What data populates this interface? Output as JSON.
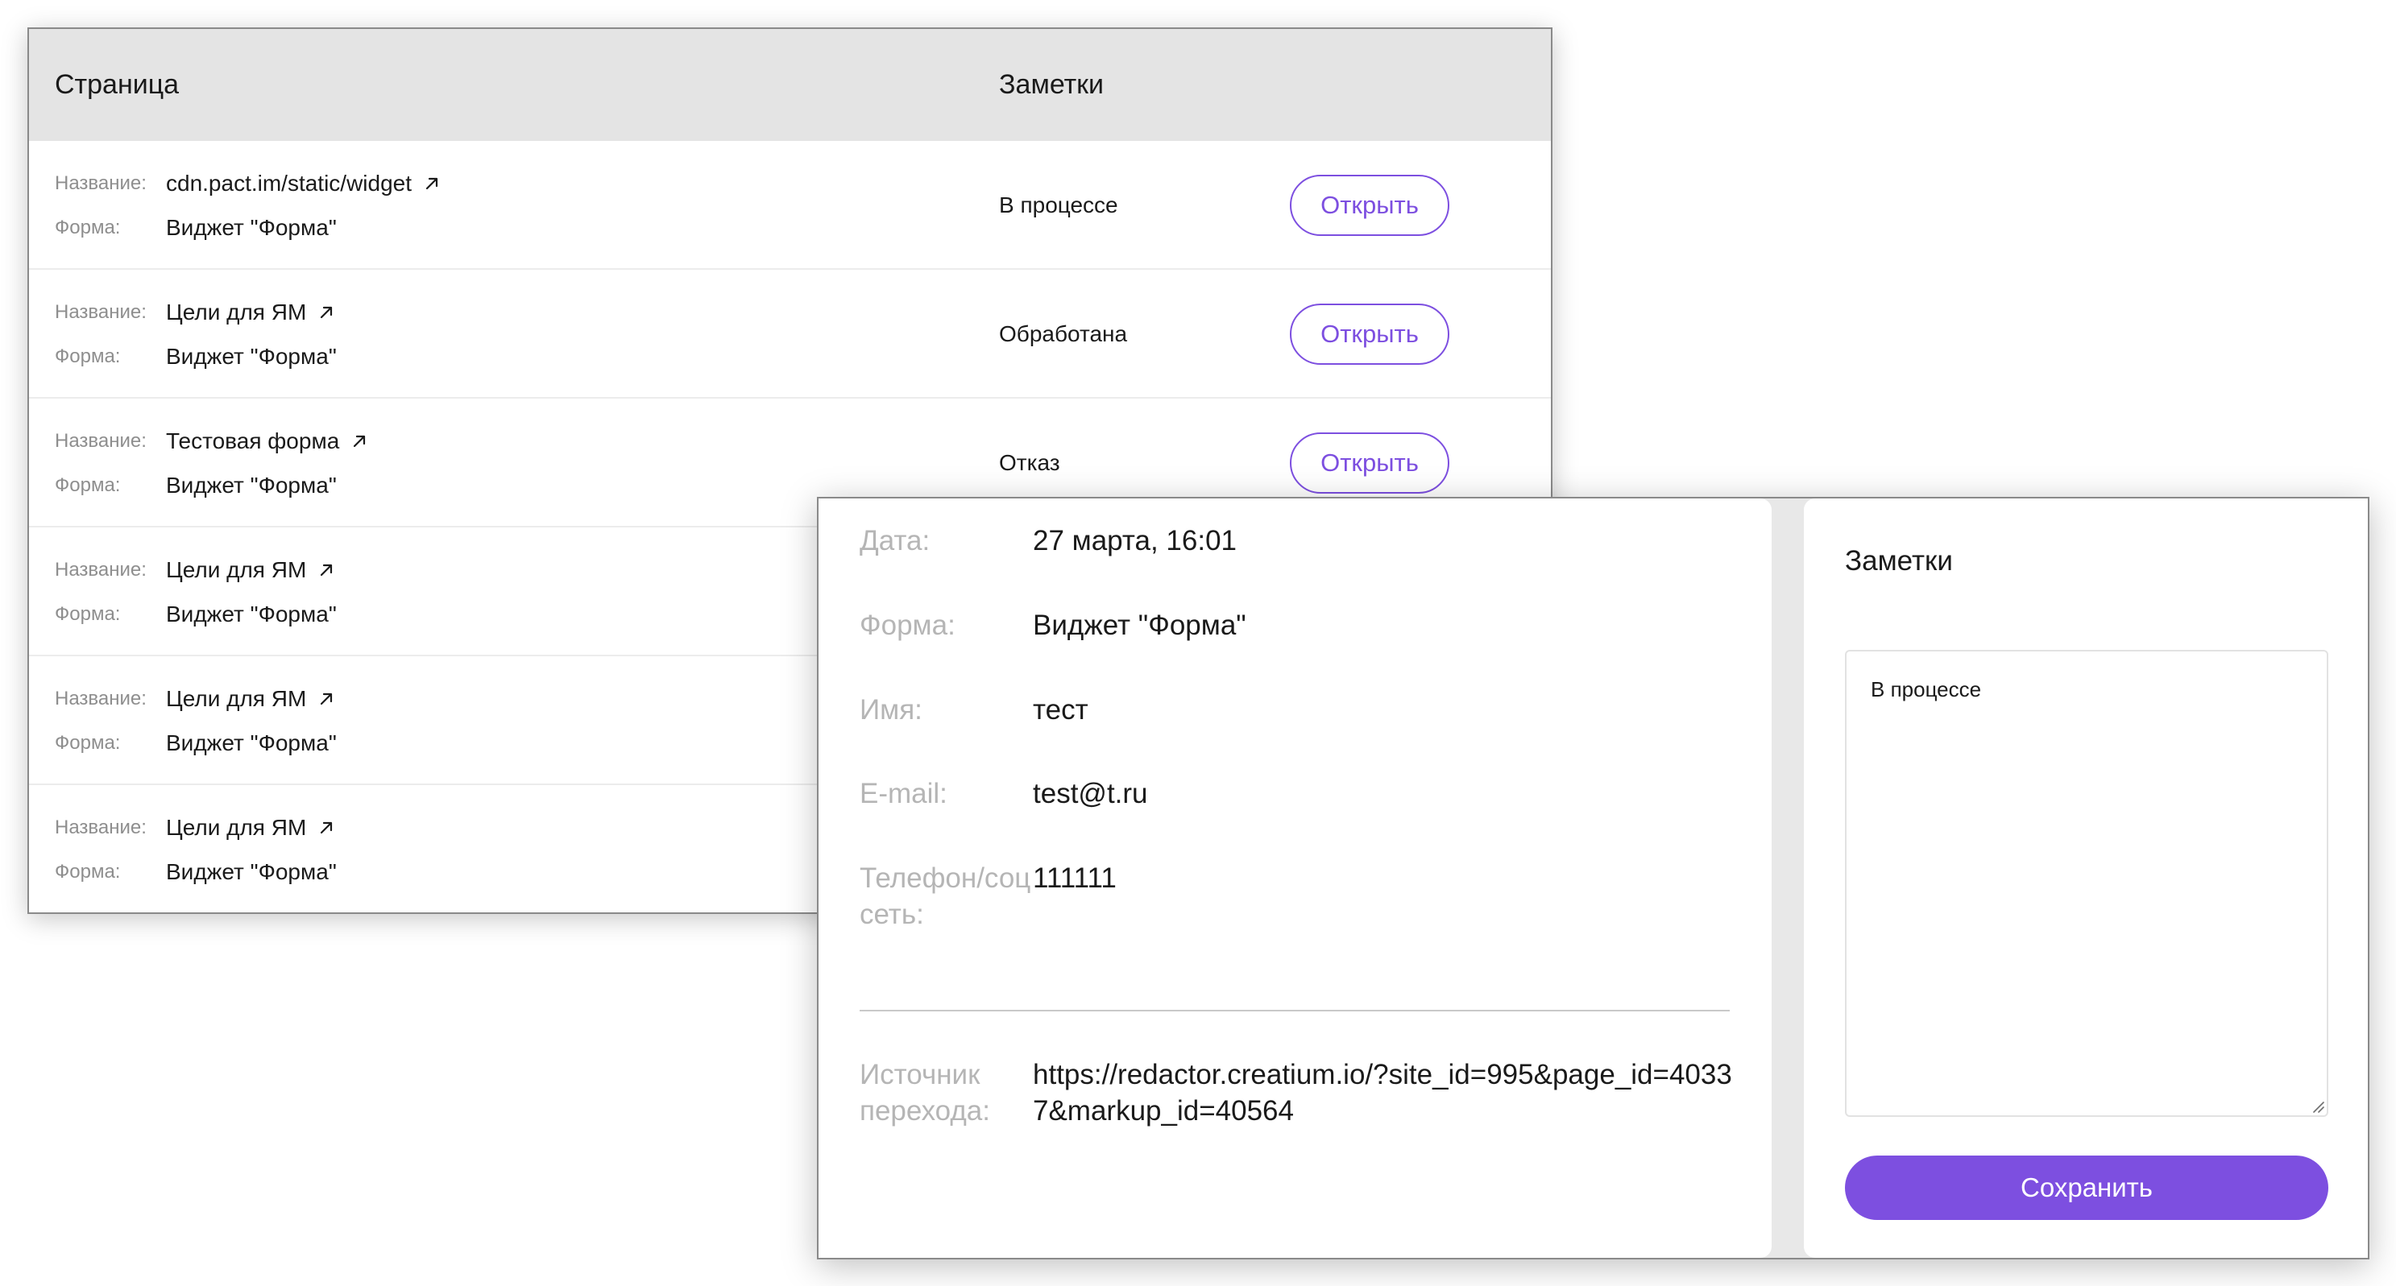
{
  "table": {
    "headers": {
      "page": "Страница",
      "notes": "Заметки"
    },
    "name_label": "Название:",
    "form_label": "Форма:",
    "open_label": "Открыть",
    "rows": [
      {
        "name": "cdn.pact.im/static/widget",
        "form": "Виджет \"Форма\"",
        "status": "В процессе"
      },
      {
        "name": "Цели для ЯМ",
        "form": "Виджет \"Форма\"",
        "status": "Обработана"
      },
      {
        "name": "Тестовая форма",
        "form": "Виджет \"Форма\"",
        "status": "Отказ"
      },
      {
        "name": "Цели для ЯМ",
        "form": "Виджет \"Форма\"",
        "status": ""
      },
      {
        "name": "Цели для ЯМ",
        "form": "Виджет \"Форма\"",
        "status": ""
      },
      {
        "name": "Цели для ЯМ",
        "form": "Виджет \"Форма\"",
        "status": ""
      }
    ]
  },
  "detail": {
    "fields": {
      "date": {
        "label": "Дата:",
        "value": "27 марта, 16:01"
      },
      "form": {
        "label": "Форма:",
        "value": "Виджет \"Форма\""
      },
      "name": {
        "label": "Имя:",
        "value": "тест"
      },
      "email": {
        "label": "E-mail:",
        "value": "test@t.ru"
      },
      "phone": {
        "label": "Телефон/соцсеть:",
        "value": "111111"
      },
      "source": {
        "label": "Источник перехода:",
        "value": "https://redactor.creatium.io/?site_id=995&page_id=40337&markup_id=40564"
      }
    },
    "notes": {
      "title": "Заметки",
      "value": "В процессе",
      "save_label": "Сохранить"
    }
  },
  "colors": {
    "accent": "#7d4fe0",
    "header_bg": "#e4e4e4",
    "label_gray": "#8e8e8e"
  },
  "icons": {
    "external_link": "arrow-up-right-icon",
    "resize": "resize-grip-icon"
  }
}
